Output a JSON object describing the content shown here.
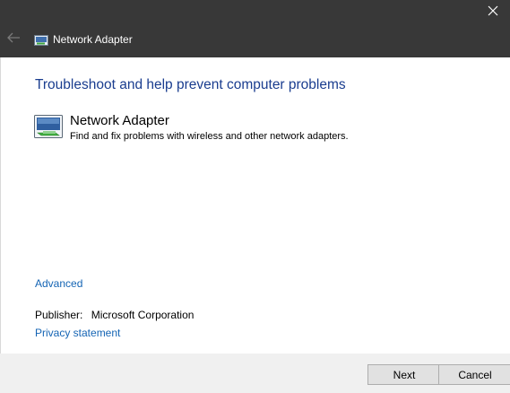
{
  "window": {
    "title": "Network Adapter"
  },
  "icons": {
    "close": "close-icon",
    "back": "back-arrow-icon",
    "title": "network-adapter-icon",
    "item": "network-adapter-large-icon"
  },
  "main": {
    "heading": "Troubleshoot and help prevent computer problems",
    "item": {
      "title": "Network Adapter",
      "description": "Find and fix problems with wireless and other network adapters."
    },
    "advanced_link": "Advanced",
    "publisher_label": "Publisher:",
    "publisher_value": "Microsoft Corporation",
    "privacy_link": "Privacy statement"
  },
  "footer": {
    "next_label": "Next",
    "cancel_label": "Cancel"
  },
  "colors": {
    "titlebar": "#383838",
    "heading": "#1a3d8f",
    "link": "#1464b4",
    "footer": "#f0f0f0"
  }
}
